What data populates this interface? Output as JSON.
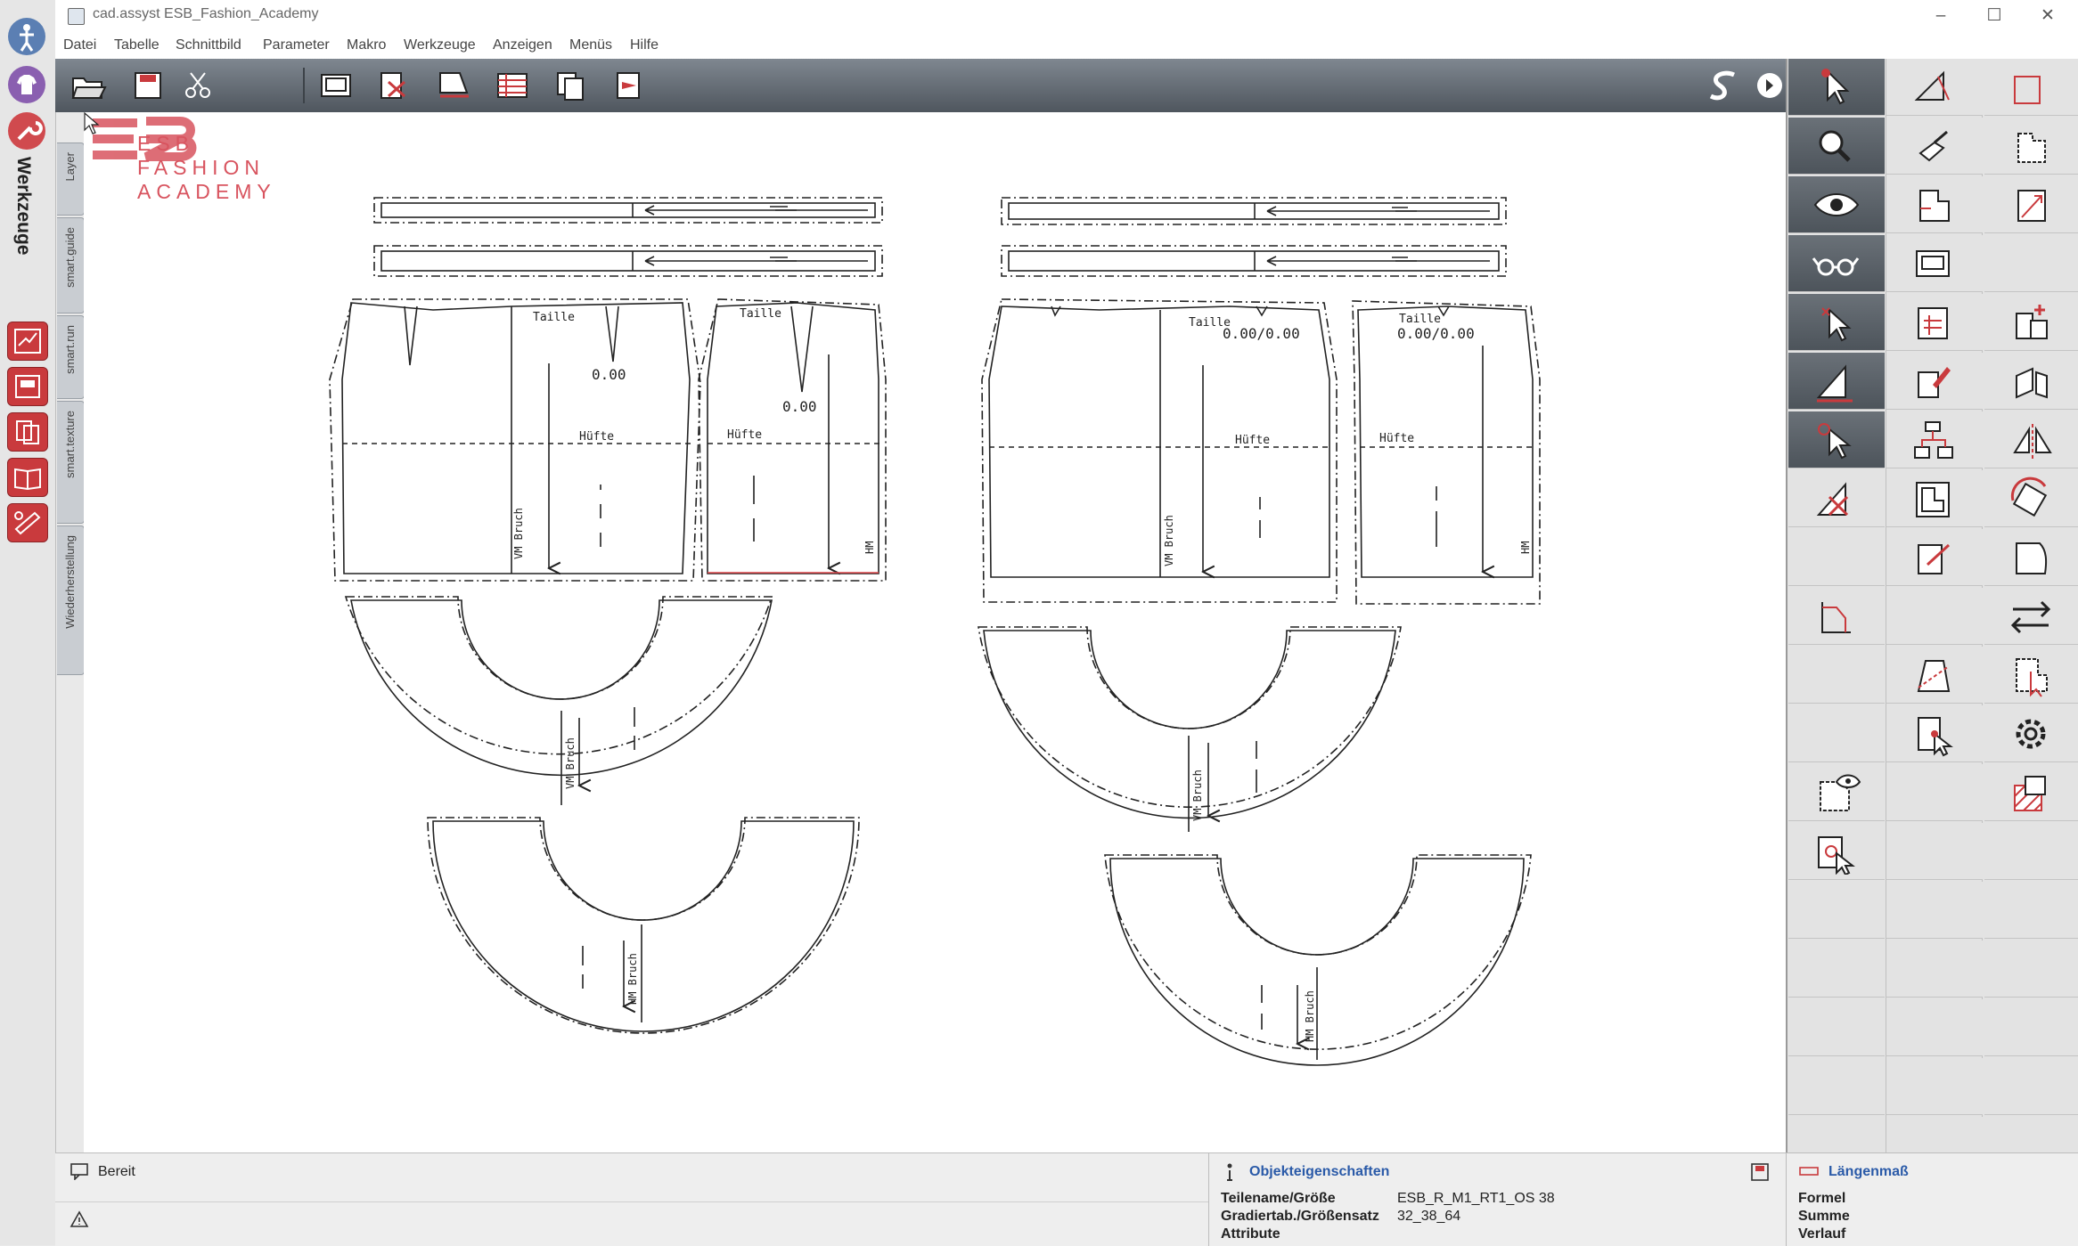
{
  "window": {
    "title": "cad.assyst  ESB_Fashion_Academy",
    "buttons": [
      "–",
      "☐",
      "✕"
    ]
  },
  "menu": [
    "Datei",
    "Tabelle",
    "Schnittbild",
    "Parameter",
    "Makro",
    "Werkzeuge",
    "Anzeigen",
    "Menüs",
    "Hilfe"
  ],
  "left_sidebar": {
    "title": "Werkzeuge",
    "top_icons": [
      "figure-icon",
      "shirt-icon",
      "wrench-icon"
    ],
    "tool_buttons": [
      "grading-tool-icon",
      "plot-tool-icon",
      "piece-copy-tool-icon",
      "book-tool-icon",
      "measure-tool-icon"
    ],
    "vertical_tabs": [
      "Layer",
      "smart.guide",
      "smart.run",
      "smart.texture",
      "Wiederherstellung"
    ]
  },
  "logo": {
    "lines": [
      "ESB",
      "FASHION",
      "ACADEMY"
    ],
    "color": "#d8545f"
  },
  "toolbar": {
    "icons": [
      "open-file-icon",
      "save-file-icon",
      "cut-icon",
      "print-icon",
      "plotter-icon",
      "delete-piece-icon",
      "seam-icon",
      "table-icon",
      "copy-icon",
      "export-icon",
      "assyst-logo-icon",
      "collapse-arrow-icon"
    ]
  },
  "pattern": {
    "labels": {
      "taille": "Taille",
      "huefte": "Hüfte",
      "vm_bruch": "VM Bruch",
      "hm_bruch": "HM Bruch",
      "hm": "HM",
      "zero": "0.00",
      "zero_pair": "0.00/0.00"
    }
  },
  "right_panel": {
    "icons": [
      "select-arrow-icon",
      "construction-tool-icon",
      "label-text-icon",
      "zoom-icon",
      "stamp-icon",
      "corner-piece-icon",
      "eye-icon",
      "dart-piece-icon",
      "scale-piece-icon",
      "glasses-icon",
      "plotter-frame-icon",
      "empty",
      "select-point-icon",
      "table-piece-icon",
      "add-piece-icon",
      "set-square-icon",
      "edit-piece-icon",
      "split-piece-icon",
      "select-gear-icon",
      "hierarchy-icon",
      "mirror-icon",
      "delete-point-icon",
      "layout-piece-icon",
      "rotate-piece-icon",
      "empty",
      "edit-note-icon",
      "curve-piece-icon",
      "axis-icon",
      "empty",
      "swap-arrows-icon",
      "empty",
      "split-line-icon",
      "grade-piece-icon",
      "empty",
      "piece-select-icon",
      "settings-gear-icon",
      "show-piece-icon",
      "empty",
      "hatched-piece-icon",
      "piece-cursor-icon",
      "empty",
      "empty"
    ]
  },
  "statusbar": {
    "status": "Bereit",
    "properties_title": "Objekteigenschaften",
    "properties": [
      {
        "label": "Teilename/Größe",
        "value": "ESB_R_M1_RT1_OS 38"
      },
      {
        "label": "Gradiertab./Größensatz",
        "value": "32_38_64"
      },
      {
        "label": "Attribute",
        "value": ""
      }
    ],
    "measure_title": "Längenmaß",
    "measure_rows": [
      "Formel",
      "Summe",
      "Verlauf"
    ]
  }
}
